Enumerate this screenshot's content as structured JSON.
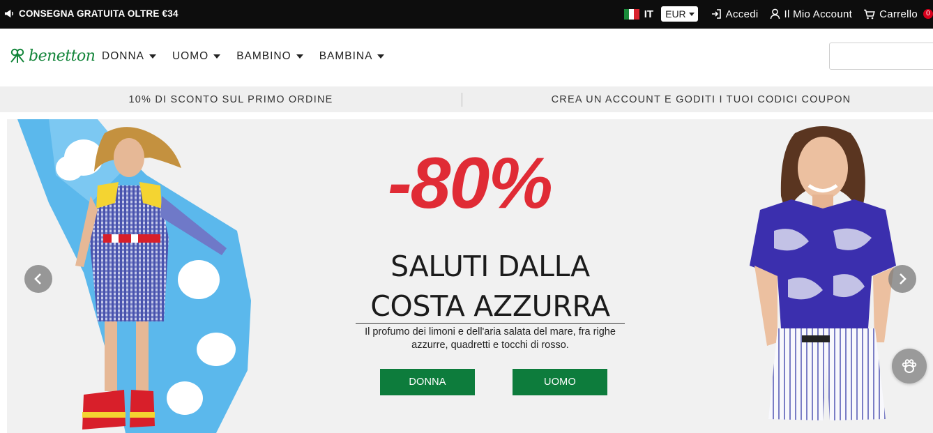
{
  "topbar": {
    "shipping_text": "CONSEGNA GRATUITA OLTRE €34",
    "language": "IT",
    "currency": "EUR",
    "login_label": "Accedi",
    "account_label": "Il Mio Account",
    "cart_label": "Carrello",
    "cart_count": "0",
    "icons": [
      "megaphone-icon",
      "italy-flag-icon",
      "login-icon",
      "user-icon",
      "cart-icon"
    ]
  },
  "header": {
    "logo_text": "benetton",
    "nav": [
      {
        "label": "DONNA"
      },
      {
        "label": "UOMO"
      },
      {
        "label": "BAMBINO"
      },
      {
        "label": "BAMBINA"
      }
    ],
    "search_placeholder": ""
  },
  "promo": {
    "left": "10% DI SCONTO SUL PRIMO ORDINE",
    "right": "CREA UN ACCOUNT E GODITI I TUOI CODICI COUPON"
  },
  "hero": {
    "discount": "-80%",
    "headline_line1": "SALUTI DALLA",
    "headline_line2": "COSTA AZZURRA",
    "description": "Il profumo dei limoni e dell'aria salata del mare, fra righe azzurre, quadretti e tocchi di rosso.",
    "cta_women": "DONNA",
    "cta_men": "UOMO"
  },
  "colors": {
    "topbar_bg": "#0d0d0d",
    "brand_green": "#13853a",
    "cta_green": "#0d7c3c",
    "discount_red": "#e02b35",
    "promo_bg": "#efefef",
    "hero_bg": "#f1f1f1"
  }
}
